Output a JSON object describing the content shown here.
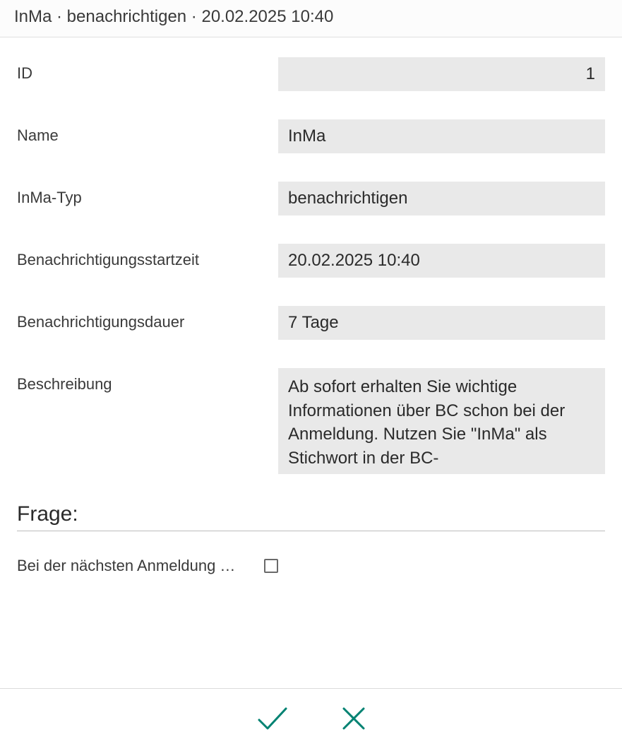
{
  "header": {
    "title": "InMa · benachrichtigen · 20.02.2025 10:40"
  },
  "fields": {
    "id": {
      "label": "ID",
      "value": "1"
    },
    "name": {
      "label": "Name",
      "value": "InMa"
    },
    "type": {
      "label": "InMa-Typ",
      "value": "benachrichtigen"
    },
    "start": {
      "label": "Benachrichtigungsstartzeit",
      "value": "20.02.2025 10:40"
    },
    "duration": {
      "label": "Benachrichtigungsdauer",
      "value": "7 Tage"
    },
    "description": {
      "label": "Beschreibung",
      "value": "Ab sofort erhalten Sie wichtige Informationen über BC schon bei der Anmeldung. Nutzen Sie \"InMa\" als Stichwort in der BC-"
    }
  },
  "section": {
    "title": "Frage:"
  },
  "question": {
    "label": "Bei der nächsten Anmeldung …"
  },
  "colors": {
    "accent": "#008272"
  }
}
